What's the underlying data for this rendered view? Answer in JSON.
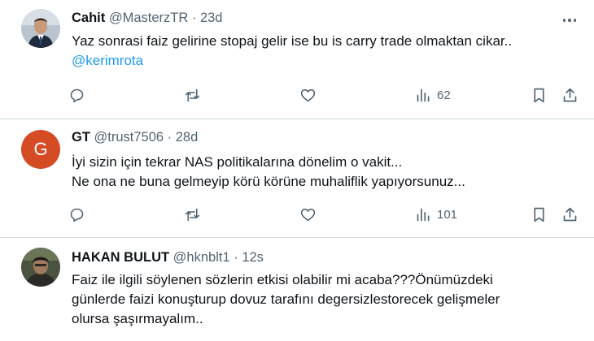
{
  "tweets": [
    {
      "name": "Cahit",
      "handle": "@MasterzTR",
      "separator": "·",
      "time": "23d",
      "lines": [
        "Yaz sonrasi faiz gelirine stopaj gelir ise bu is carry trade olmaktan cikar.."
      ],
      "mention": "@kerimrota",
      "views": "62"
    },
    {
      "name": "GT",
      "handle": "@trust7506",
      "separator": "·",
      "time": "28d",
      "avatar_letter": "G",
      "lines": [
        "İyi sizin için tekrar  NAS politikalarına dönelim o vakit...",
        "Ne ona ne buna gelmeyip körü körüne muhaliflik  yapıyorsunuz..."
      ],
      "views": "101"
    },
    {
      "name": "HAKAN BULUT",
      "handle": "@hknblt1",
      "separator": "·",
      "time": "12s",
      "lines": [
        "Faiz ile ilgili söylenen sözlerin etkisi olabilir mi acaba???Önümüzdeki",
        "günlerde faizi konuşturup dovuz tarafını degersizlestorecek gelişmeler",
        "olursa şaşırmayalım.."
      ]
    }
  ],
  "icons": [
    "reply-icon",
    "retweet-icon",
    "like-icon",
    "views-icon",
    "bookmark-icon",
    "share-icon"
  ],
  "colors": {
    "text": "#0f1419",
    "secondary": "#536471",
    "link": "#1d9bf0",
    "divider": "#cfd9de",
    "letter_avatar": "#d44b24"
  }
}
